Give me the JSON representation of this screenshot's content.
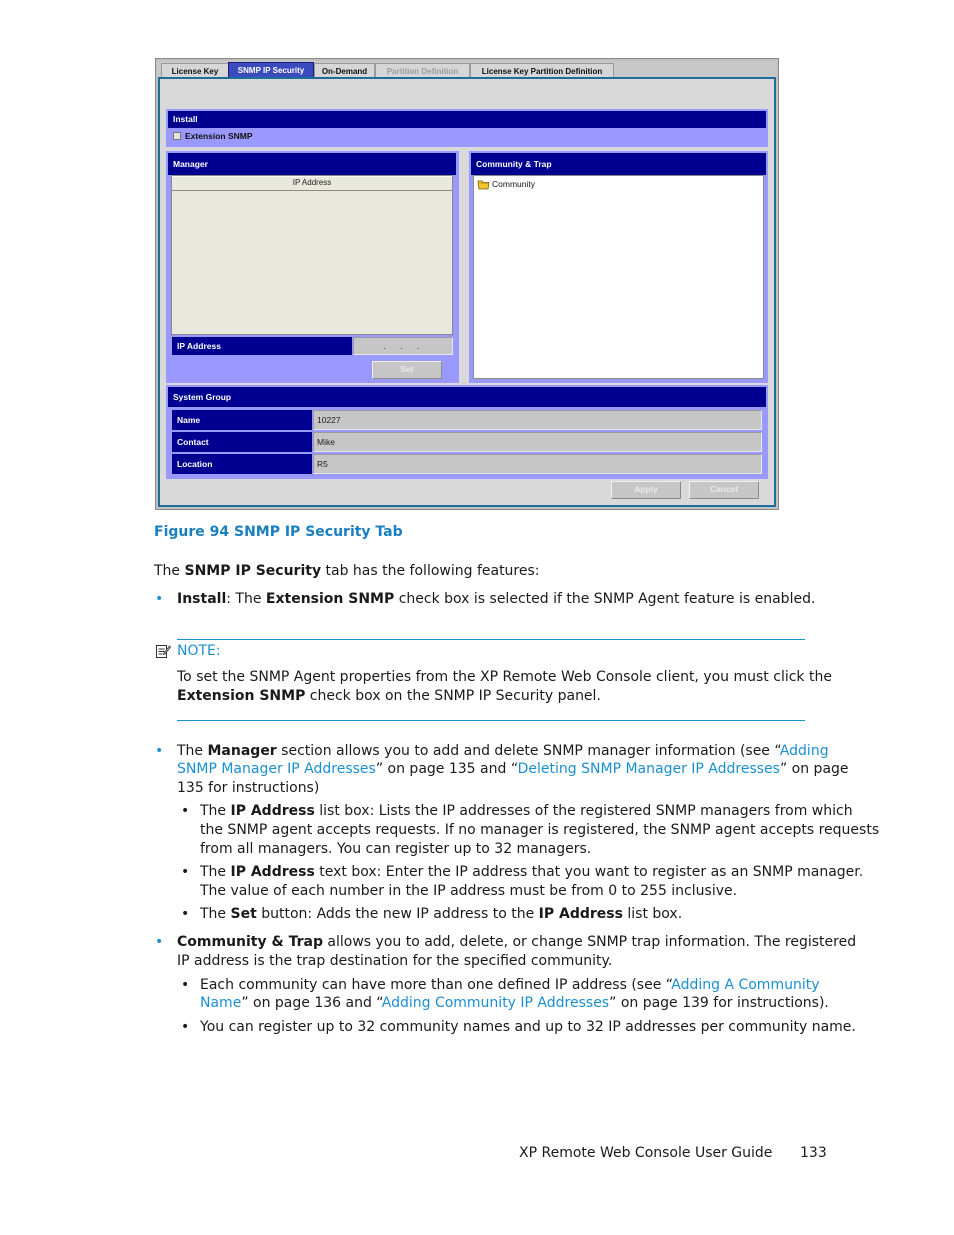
{
  "screenshot": {
    "tabs": [
      {
        "label": "License Key",
        "state": "normal"
      },
      {
        "label": "SNMP IP Security",
        "state": "active"
      },
      {
        "label": "On-Demand",
        "state": "normal"
      },
      {
        "label": "Partition Definition",
        "state": "disabled"
      },
      {
        "label": "License Key Partition Definition",
        "state": "normal"
      }
    ],
    "install": {
      "header": "Install",
      "checkbox_label": "Extension SNMP",
      "checked": false
    },
    "manager": {
      "header": "Manager",
      "list_column": "IP Address",
      "list_items": [],
      "ip_label": "IP Address",
      "ip_value": ". . .",
      "set_button": "Set"
    },
    "community": {
      "header": "Community & Trap",
      "tree_root": "Community",
      "tree_icon": "folder-icon"
    },
    "system_group": {
      "header": "System Group",
      "rows": [
        {
          "label": "Name",
          "value": "10227"
        },
        {
          "label": "Contact",
          "value": "Mike"
        },
        {
          "label": "Location",
          "value": "R5"
        }
      ]
    },
    "buttons": {
      "apply": "Apply",
      "cancel": "Cancel"
    },
    "colors": {
      "header_bar": "#000090",
      "panel_bg": "#9999ff",
      "active_tab": "#3a4bbd",
      "frame_border": "#1d6f9a"
    }
  },
  "document": {
    "caption": "Figure 94 SNMP IP Security Tab",
    "intro": {
      "pre": "The ",
      "bold": "SNMP IP Security",
      "post": " tab has the following features:"
    },
    "install_bullet": {
      "b1": "Install",
      "t1": ": The ",
      "b2": "Extension SNMP",
      "t2": " check box is selected if the SNMP Agent feature is enabled."
    },
    "note": {
      "title": "NOTE:",
      "line1": "To set the SNMP Agent properties from the XP Remote Web Console client, you must click the",
      "bold": "Extension SNMP",
      "line2": " check box on the SNMP IP Security panel."
    },
    "manager_bullet": {
      "t1": "The ",
      "b1": "Manager",
      "t2": " section allows you to add and delete SNMP manager information (see “",
      "link1a": "Adding",
      "link1b": "SNMP Manager IP Addresses",
      "t3": "” on page 135 and “",
      "link2": "Deleting SNMP Manager IP Addresses",
      "t4": "” on page",
      "t5": "135 for instructions)",
      "subs": [
        {
          "l1a": "The ",
          "l1b": "IP Address",
          "l1c": " list box: Lists the IP addresses of the registered SNMP managers from which",
          "l2": "the SNMP agent accepts requests. If no manager is registered, the SNMP agent accepts requests",
          "l3": "from all managers. You can register up to 32 managers."
        },
        {
          "l1a": "The ",
          "l1b": "IP Address",
          "l1c": " text box: Enter the IP address that you want to register as an SNMP manager.",
          "l2": "The value of each number in the IP address must be from 0 to 255 inclusive."
        },
        {
          "l1a": "The ",
          "l1b": "Set",
          "l1c": " button: Adds the new IP address to the ",
          "l1d": "IP Address",
          "l1e": " list box."
        }
      ]
    },
    "community_bullet": {
      "b1": "Community & Trap",
      "t1": " allows you to add, delete, or change SNMP trap information. The registered",
      "t2": "IP address is the trap destination for the specified community.",
      "subs": [
        {
          "a": "Each community can have more than one defined IP address (see “",
          "link1a": "Adding A Community",
          "link1b": "Name",
          "b": "” on page 136 and “",
          "link2": "Adding Community IP Addresses",
          "c": "” on page 139 for instructions)."
        },
        {
          "a": "You can register up to 32 community names and up to 32 IP addresses per community name."
        }
      ]
    },
    "footer": {
      "title": "XP Remote Web Console User Guide",
      "page": "133"
    }
  }
}
